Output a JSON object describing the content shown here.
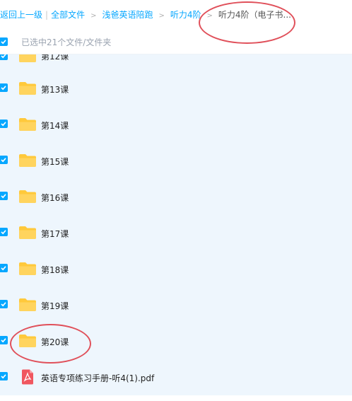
{
  "breadcrumb": {
    "back": "返回上一级",
    "all_files": "全部文件",
    "level1": "浅爸英语陪跑",
    "level2": "听力4阶",
    "current": "听力4阶（电子书..."
  },
  "selection": {
    "label": "已选中21个文件/文件夹",
    "checked": true
  },
  "files": [
    {
      "name": "第12课",
      "type": "folder",
      "checked": true
    },
    {
      "name": "第13课",
      "type": "folder",
      "checked": true
    },
    {
      "name": "第14课",
      "type": "folder",
      "checked": true
    },
    {
      "name": "第15课",
      "type": "folder",
      "checked": true
    },
    {
      "name": "第16课",
      "type": "folder",
      "checked": true
    },
    {
      "name": "第17课",
      "type": "folder",
      "checked": true
    },
    {
      "name": "第18课",
      "type": "folder",
      "checked": true
    },
    {
      "name": "第19课",
      "type": "folder",
      "checked": true
    },
    {
      "name": "第20课",
      "type": "folder",
      "checked": true
    },
    {
      "name": "英语专项练习手册-听4(1).pdf",
      "type": "pdf",
      "checked": true
    }
  ],
  "icons": {
    "folder": "folder-icon",
    "pdf": "pdf-icon",
    "checkbox": "checkbox-checked-icon"
  },
  "colors": {
    "accent": "#06a7ff",
    "folder": "#ffc93b",
    "pdf": "#f0565f",
    "annotation": "#e0505a",
    "list_background": "#eef6fd"
  }
}
